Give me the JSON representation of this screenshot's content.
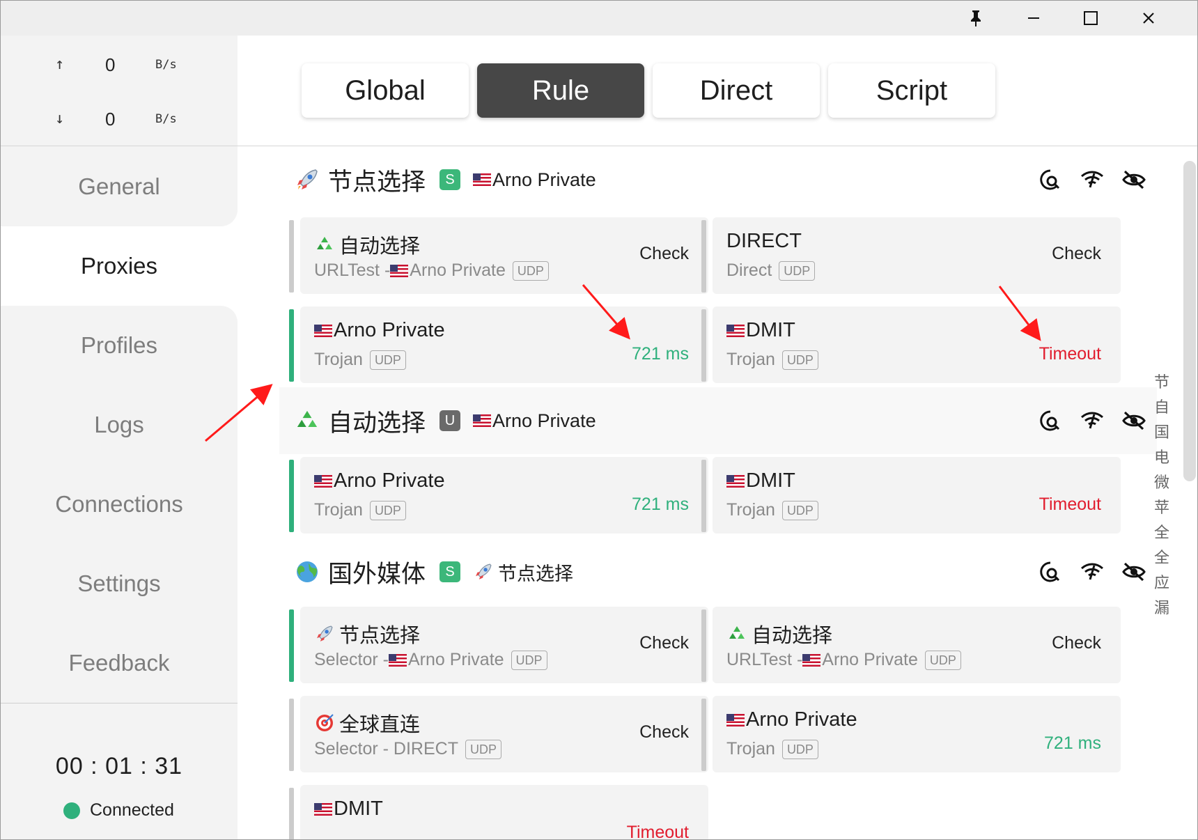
{
  "window": {
    "controls": [
      "pin-icon",
      "minimize-icon",
      "maximize-icon",
      "close-icon"
    ]
  },
  "traffic": {
    "up": {
      "arrow": "↑",
      "value": "0",
      "unit": "B/s"
    },
    "down": {
      "arrow": "↓",
      "value": "0",
      "unit": "B/s"
    }
  },
  "nav": {
    "items": [
      "General",
      "Proxies",
      "Profiles",
      "Logs",
      "Connections",
      "Settings",
      "Feedback"
    ],
    "active": "Proxies"
  },
  "status": {
    "timer": "00 : 01 : 31",
    "connection": "Connected",
    "connection_color": "#2fb07c"
  },
  "modes": {
    "items": [
      "Global",
      "Rule",
      "Direct",
      "Script"
    ],
    "active": "Rule"
  },
  "groups": [
    {
      "icon": "rocket-icon",
      "name": "节点选择",
      "badge": "S",
      "current": "Arno Private",
      "current_flag": "us-flag-icon",
      "proxies": [
        {
          "icon": "recycle-icon",
          "name": "自动选择",
          "type": "URLTest - ",
          "sub_flag": "us-flag-icon",
          "sub_name": "Arno Private",
          "udp": "UDP",
          "status": "Check",
          "status_kind": "check",
          "selected": false
        },
        {
          "icon": "",
          "name": "DIRECT",
          "type": "Direct",
          "udp": "UDP",
          "status": "Check",
          "status_kind": "check",
          "selected": false
        },
        {
          "icon": "us-flag-icon",
          "name": "Arno Private",
          "type": "Trojan",
          "udp": "UDP",
          "status": "721 ms",
          "status_kind": "ok",
          "selected": true
        },
        {
          "icon": "us-flag-icon",
          "name": "DMIT",
          "type": "Trojan",
          "udp": "UDP",
          "status": "Timeout",
          "status_kind": "bad",
          "selected": false
        }
      ]
    },
    {
      "icon": "recycle-icon",
      "name": "自动选择",
      "badge": "U",
      "current": "Arno Private",
      "current_flag": "us-flag-icon",
      "proxies": [
        {
          "icon": "us-flag-icon",
          "name": "Arno Private",
          "type": "Trojan",
          "udp": "UDP",
          "status": "721 ms",
          "status_kind": "ok",
          "selected": true
        },
        {
          "icon": "us-flag-icon",
          "name": "DMIT",
          "type": "Trojan",
          "udp": "UDP",
          "status": "Timeout",
          "status_kind": "bad",
          "selected": false
        }
      ]
    },
    {
      "icon": "globe-icon",
      "name": "国外媒体",
      "badge": "S",
      "current": "节点选择",
      "current_flag": "rocket-icon",
      "proxies": [
        {
          "icon": "rocket-icon",
          "name": "节点选择",
          "type": "Selector - ",
          "sub_flag": "us-flag-icon",
          "sub_name": "Arno Private",
          "udp": "UDP",
          "status": "Check",
          "status_kind": "check",
          "selected": true
        },
        {
          "icon": "recycle-icon",
          "name": "自动选择",
          "type": "URLTest - ",
          "sub_flag": "us-flag-icon",
          "sub_name": "Arno Private",
          "udp": "UDP",
          "status": "Check",
          "status_kind": "check",
          "selected": false
        },
        {
          "icon": "target-icon",
          "name": "全球直连",
          "type": "Selector - DIRECT",
          "udp": "UDP",
          "status": "Check",
          "status_kind": "check",
          "selected": false
        },
        {
          "icon": "us-flag-icon",
          "name": "Arno Private",
          "type": "Trojan",
          "udp": "UDP",
          "status": "721 ms",
          "status_kind": "ok",
          "selected": false
        },
        {
          "icon": "us-flag-icon",
          "name": "DMIT",
          "type": "",
          "udp": "",
          "status": "Timeout",
          "status_kind": "bad",
          "selected": false
        }
      ]
    }
  ],
  "group_header_icons": [
    "latency-test-icon",
    "wifi-test-icon",
    "eye-off-icon"
  ],
  "group_index": [
    "节",
    "自",
    "国",
    "电",
    "微",
    "苹",
    "全",
    "全",
    "应",
    "漏"
  ],
  "colors": {
    "accent_green": "#2fb07c",
    "timeout_red": "#e11d2e",
    "active_mode_bg": "#474747",
    "annotation_red": "#ff1a1a"
  }
}
